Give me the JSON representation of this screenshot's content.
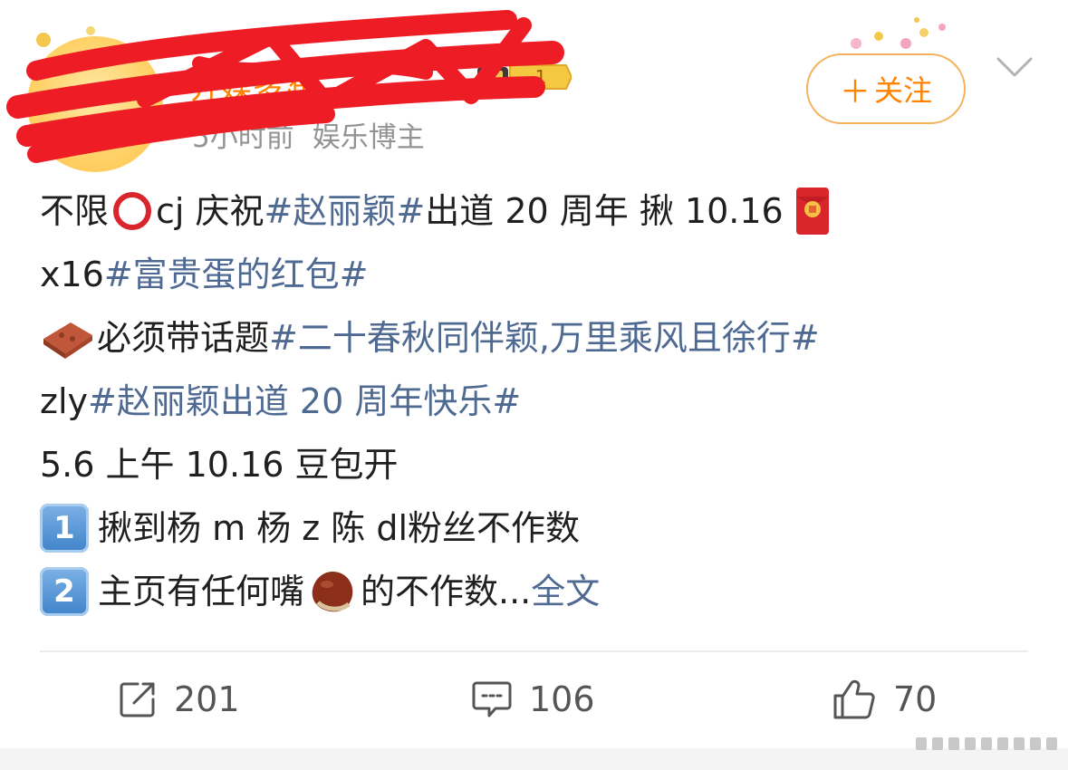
{
  "post": {
    "author": {
      "name": "开媒多准",
      "meta_time": "5小时前",
      "meta_role": "娱乐博主",
      "vip_level": "1"
    },
    "follow_label": "关注",
    "follow_plus": "＋",
    "content": {
      "l1_a": "不限",
      "l1_b": "cj 庆祝",
      "l1_tag": "#赵丽颖#",
      "l1_c": " 出道 20 周年 揪 10.16",
      "l2_a": "x16 ",
      "l2_tag": "#富贵蛋的红包#",
      "l3_a": " 必须带话题",
      "l3_tag": "#二十春秋同伴颖,万里乘风且徐行#",
      "l4_a": "zly",
      "l4_tag": "#赵丽颖出道 20 周年快乐#",
      "l5": "5.6 上午 10.16 豆包开",
      "l6_key": "1",
      "l6": "揪到杨 m 杨 z 陈 dl粉丝不作数",
      "l7_key": "2",
      "l7_a": "主页有任何嘴",
      "l7_b": "的不作数...",
      "more": " 全文"
    },
    "stats": {
      "reposts": "201",
      "comments": "106",
      "likes": "70"
    },
    "colors": {
      "accent": "#ff8200",
      "link": "#4f6a92",
      "meta": "#939393",
      "text": "#1f1f1f",
      "redaction": "#ee1c25"
    },
    "icons": {
      "repost": "repost-icon",
      "comment": "comment-icon",
      "like": "thumbs-up-icon",
      "more": "chevron-down-icon"
    }
  }
}
